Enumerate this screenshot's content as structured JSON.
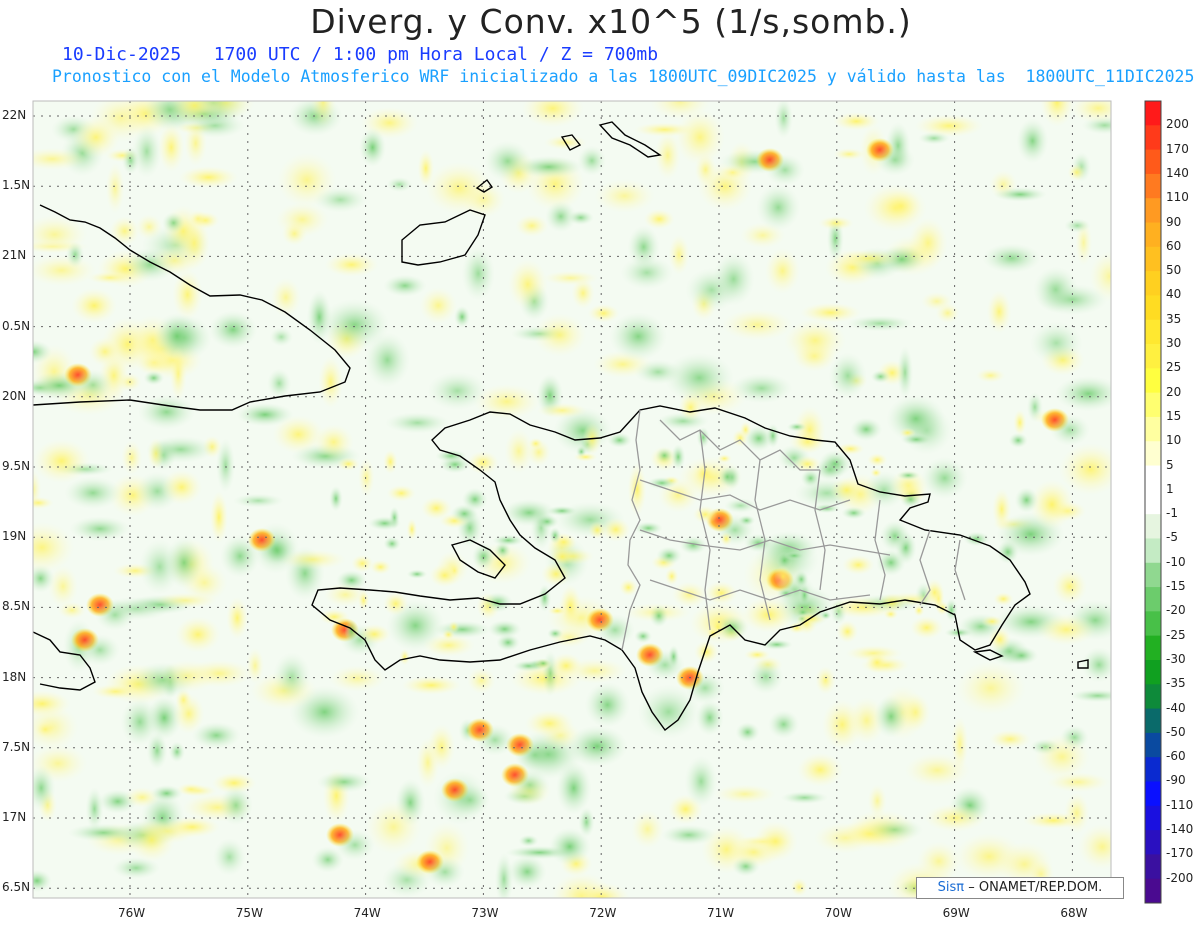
{
  "title": "Diverg. y Conv. x10^5 (1/s,somb.)",
  "subtitle_1": "10-Dic-2025   1700 UTC / 1:00 pm Hora Local / Z = 700mb",
  "subtitle_2": "Pronostico con el Modelo Atmosferico WRF inicializado a las 1800UTC_09DIC2025 y válido hasta las  1800UTC_11DIC2025",
  "lat_labels": [
    "22N",
    "1.5N",
    "21N",
    "0.5N",
    "20N",
    "9.5N",
    "19N",
    "8.5N",
    "18N",
    "7.5N",
    "17N",
    "6.5N"
  ],
  "lon_labels": [
    "76W",
    "75W",
    "74W",
    "73W",
    "72W",
    "71W",
    "70W",
    "69W",
    "68W"
  ],
  "colorbar": {
    "labels": [
      "200",
      "170",
      "140",
      "110",
      "90",
      "60",
      "50",
      "40",
      "35",
      "30",
      "25",
      "20",
      "15",
      "10",
      "5",
      "1",
      "-1",
      "-5",
      "-10",
      "-15",
      "-20",
      "-25",
      "-30",
      "-35",
      "-40",
      "-50",
      "-60",
      "-90",
      "-110",
      "-140",
      "-170",
      "-200"
    ],
    "colors": [
      "#ff1a1a",
      "#ff3a1a",
      "#ff5a1a",
      "#ff7a20",
      "#ff9a22",
      "#ffb020",
      "#ffc020",
      "#ffd020",
      "#ffdc22",
      "#ffe830",
      "#fff040",
      "#ffff40",
      "#ffff70",
      "#ffffa0",
      "#ffffd0",
      "#ffffff",
      "#ffffff",
      "#e6f5e0",
      "#c4ebc4",
      "#90d890",
      "#6ccc6c",
      "#48c048",
      "#22b022",
      "#10a020",
      "#0e8a3a",
      "#0a6a6a",
      "#0a4aa0",
      "#0a2ad0",
      "#0a10ff",
      "#1a10e0",
      "#2a10c0",
      "#3a10a0",
      "#4a0a90"
    ]
  },
  "credit": {
    "brand": "Sisπ",
    "text": "– ONAMET/REP.DOM."
  },
  "colors": {
    "divergence": "#ffe830",
    "convergence": "#48c048",
    "coast": "#000000",
    "provinces": "#999999"
  }
}
